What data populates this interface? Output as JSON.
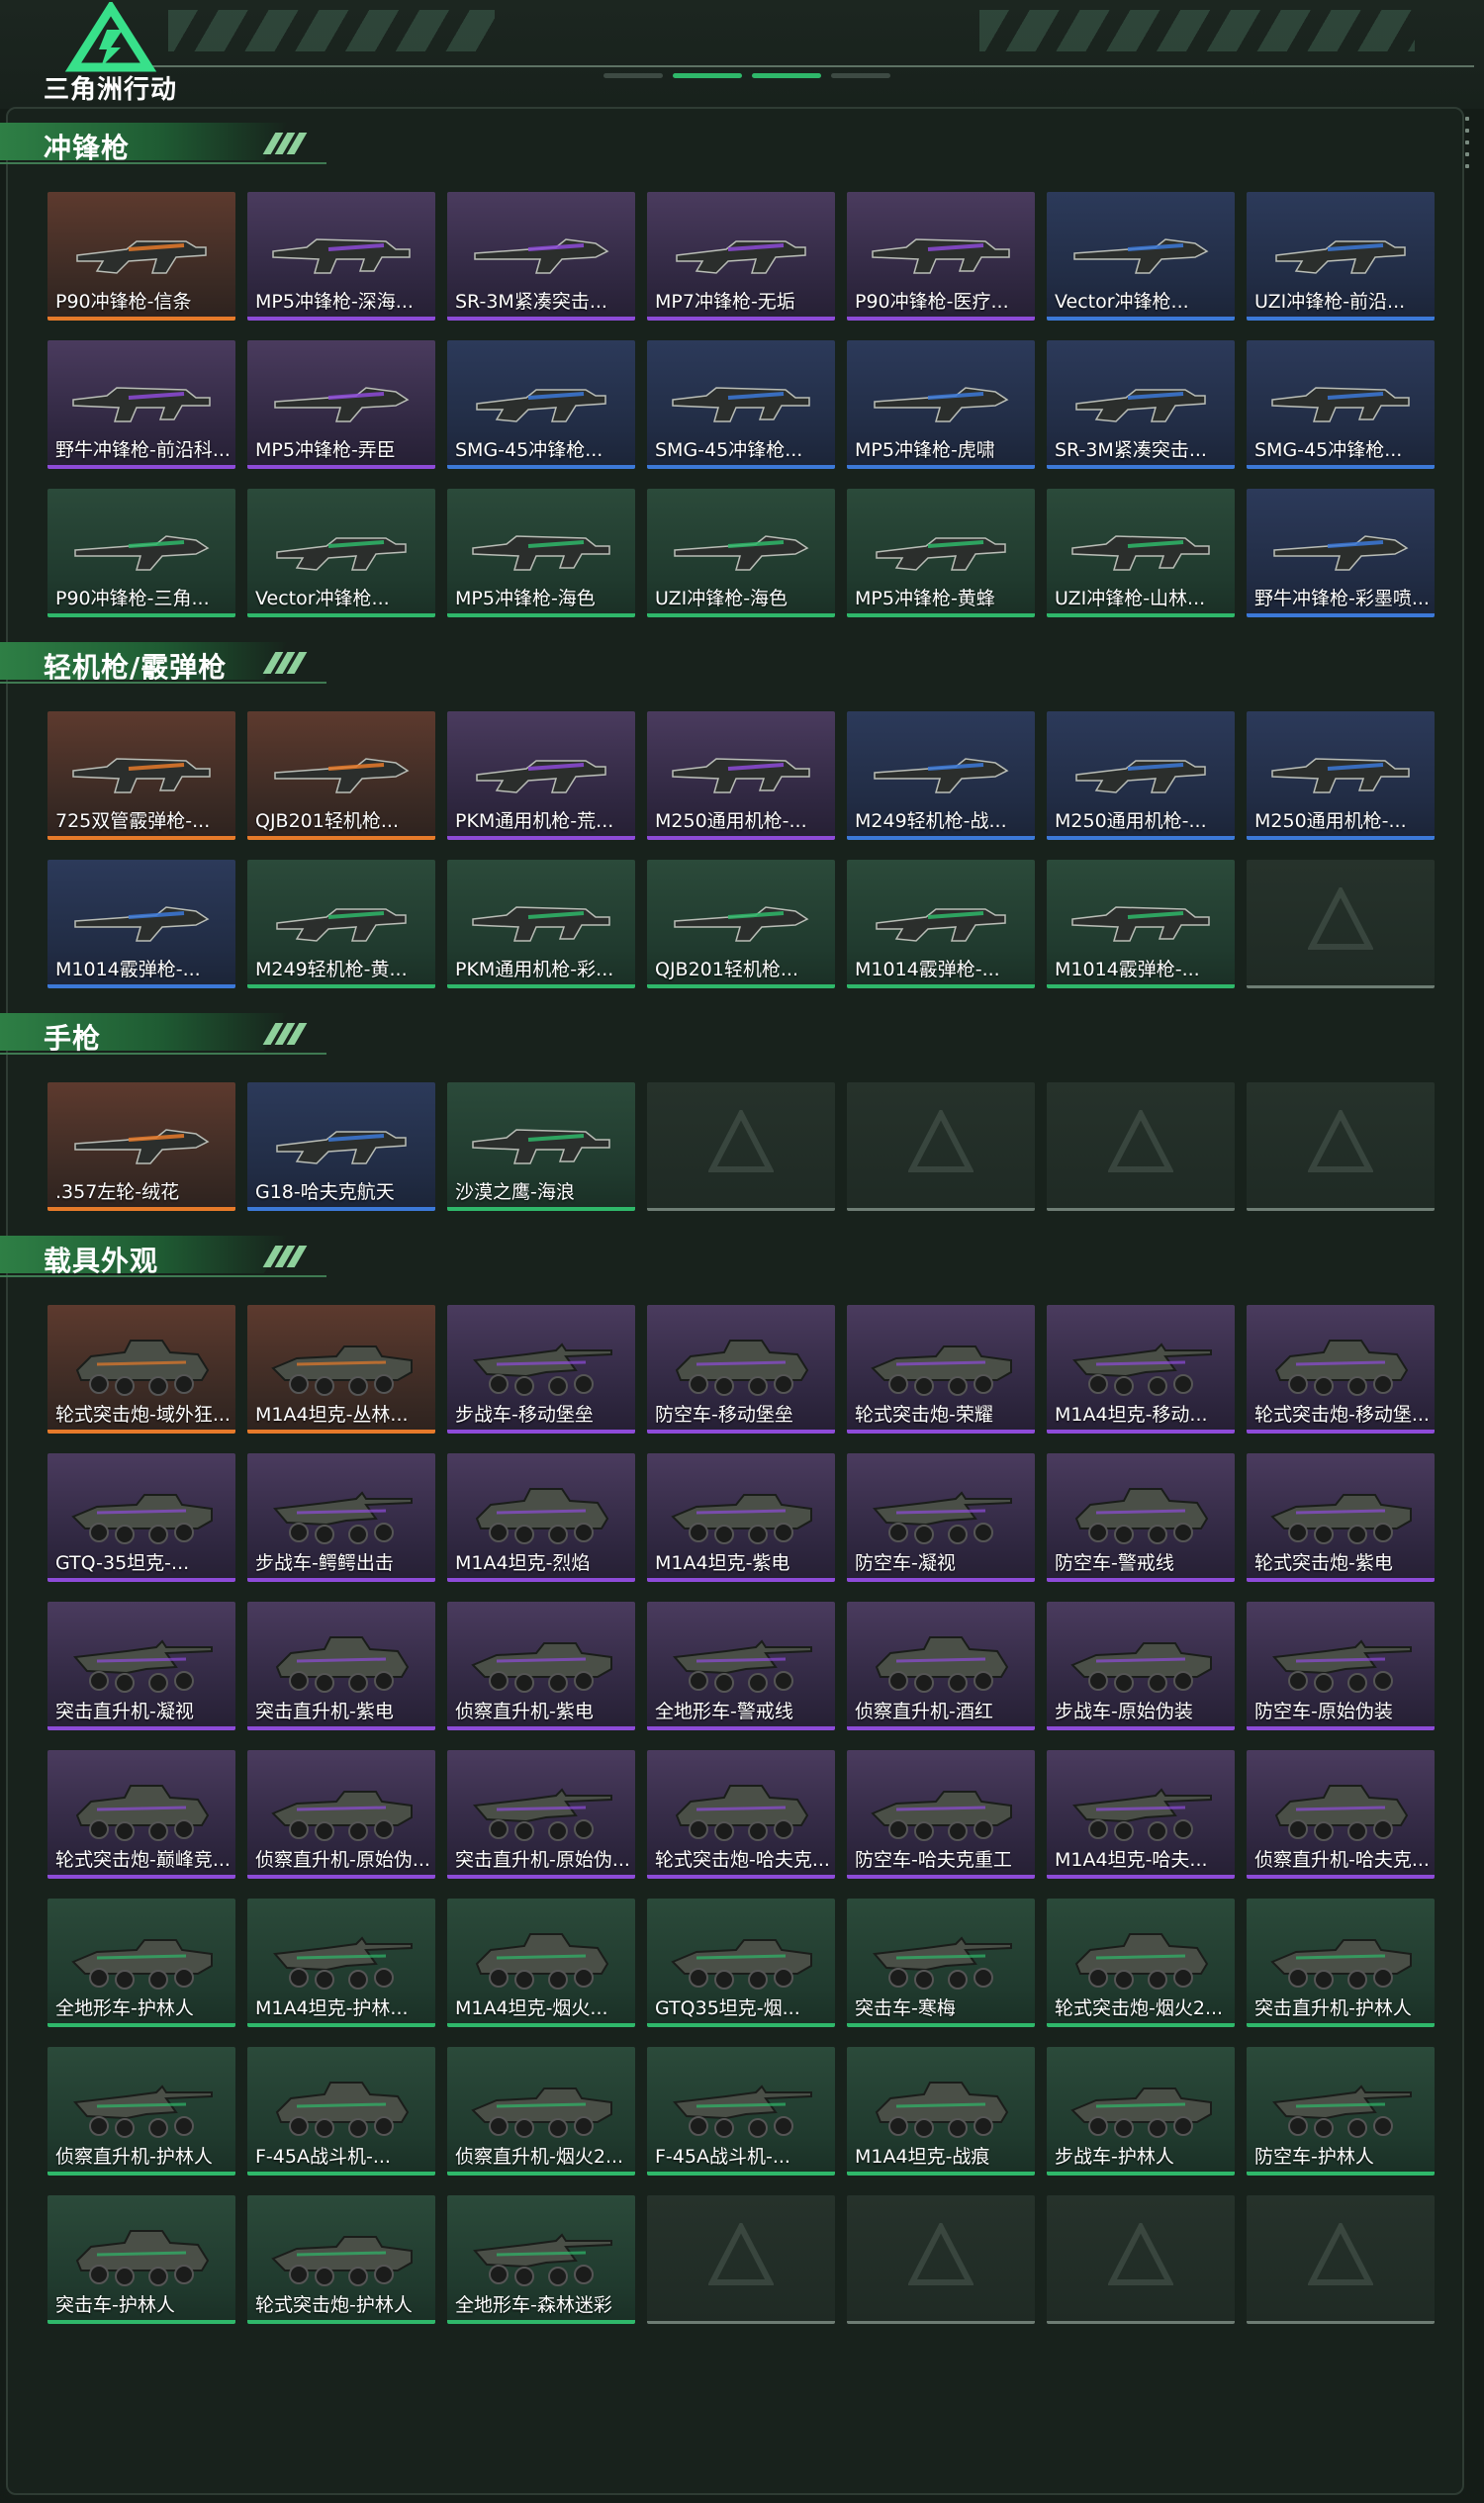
{
  "app": {
    "title": "三角洲行动"
  },
  "colors": {
    "orange": "#e67a2a",
    "purple": "#8d4bd8",
    "blue": "#3c79d8",
    "green": "#2fb86a",
    "accent": "#2e7f45"
  },
  "sections": [
    {
      "title": "冲锋枪",
      "kind": "weapon",
      "items": [
        {
          "name": "P90冲锋枪-信条",
          "rarity": "orange"
        },
        {
          "name": "MP5冲锋枪-深海...",
          "rarity": "purple"
        },
        {
          "name": "SR-3M紧凑突击...",
          "rarity": "purple"
        },
        {
          "name": "MP7冲锋枪-无垢",
          "rarity": "purple"
        },
        {
          "name": "P90冲锋枪-医疗...",
          "rarity": "purple"
        },
        {
          "name": "Vector冲锋枪...",
          "rarity": "blue"
        },
        {
          "name": "UZI冲锋枪-前沿...",
          "rarity": "blue"
        },
        {
          "name": "野牛冲锋枪-前沿科...",
          "rarity": "purple"
        },
        {
          "name": "MP5冲锋枪-弄臣",
          "rarity": "purple"
        },
        {
          "name": "SMG-45冲锋枪...",
          "rarity": "blue"
        },
        {
          "name": "SMG-45冲锋枪...",
          "rarity": "blue"
        },
        {
          "name": "MP5冲锋枪-虎啸",
          "rarity": "blue"
        },
        {
          "name": "SR-3M紧凑突击...",
          "rarity": "blue"
        },
        {
          "name": "SMG-45冲锋枪...",
          "rarity": "blue"
        },
        {
          "name": "P90冲锋枪-三角...",
          "rarity": "green"
        },
        {
          "name": "Vector冲锋枪...",
          "rarity": "green"
        },
        {
          "name": "MP5冲锋枪-海色",
          "rarity": "green"
        },
        {
          "name": "UZI冲锋枪-海色",
          "rarity": "green"
        },
        {
          "name": "MP5冲锋枪-黄蜂",
          "rarity": "green"
        },
        {
          "name": "UZI冲锋枪-山林...",
          "rarity": "green"
        },
        {
          "name": "野牛冲锋枪-彩墨喷...",
          "rarity": "blue"
        }
      ]
    },
    {
      "title": "轻机枪/霰弹枪",
      "kind": "weapon",
      "items": [
        {
          "name": "725双管霰弹枪-...",
          "rarity": "orange"
        },
        {
          "name": "QJB201轻机枪...",
          "rarity": "orange"
        },
        {
          "name": "PKM通用机枪-荒...",
          "rarity": "purple"
        },
        {
          "name": "M250通用机枪-...",
          "rarity": "purple"
        },
        {
          "name": "M249轻机枪-战...",
          "rarity": "blue"
        },
        {
          "name": "M250通用机枪-...",
          "rarity": "blue"
        },
        {
          "name": "M250通用机枪-...",
          "rarity": "blue"
        },
        {
          "name": "M1014霰弹枪-...",
          "rarity": "blue"
        },
        {
          "name": "M249轻机枪-黄...",
          "rarity": "green"
        },
        {
          "name": "PKM通用机枪-彩...",
          "rarity": "green"
        },
        {
          "name": "QJB201轻机枪...",
          "rarity": "green"
        },
        {
          "name": "M1014霰弹枪-...",
          "rarity": "green"
        },
        {
          "name": "M1014霰弹枪-...",
          "rarity": "green"
        },
        {
          "name": "",
          "rarity": "empty"
        }
      ]
    },
    {
      "title": "手枪",
      "kind": "weapon",
      "items": [
        {
          "name": ".357左轮-绒花",
          "rarity": "orange"
        },
        {
          "name": "G18-哈夫克航天",
          "rarity": "blue"
        },
        {
          "name": "沙漠之鹰-海浪",
          "rarity": "green"
        },
        {
          "name": "",
          "rarity": "empty"
        },
        {
          "name": "",
          "rarity": "empty"
        },
        {
          "name": "",
          "rarity": "empty"
        },
        {
          "name": "",
          "rarity": "empty"
        }
      ]
    },
    {
      "title": "载具外观",
      "kind": "vehicle",
      "items": [
        {
          "name": "轮式突击炮-域外狂...",
          "rarity": "orange"
        },
        {
          "name": "M1A4坦克-丛林...",
          "rarity": "orange"
        },
        {
          "name": "步战车-移动堡垒",
          "rarity": "purple"
        },
        {
          "name": "防空车-移动堡垒",
          "rarity": "purple"
        },
        {
          "name": "轮式突击炮-荣耀",
          "rarity": "purple"
        },
        {
          "name": "M1A4坦克-移动...",
          "rarity": "purple"
        },
        {
          "name": "轮式突击炮-移动堡...",
          "rarity": "purple"
        },
        {
          "name": "GTQ-35坦克-...",
          "rarity": "purple"
        },
        {
          "name": "步战车-鳄鳄出击",
          "rarity": "purple"
        },
        {
          "name": "M1A4坦克-烈焰",
          "rarity": "purple"
        },
        {
          "name": "M1A4坦克-紫电",
          "rarity": "purple"
        },
        {
          "name": "防空车-凝视",
          "rarity": "purple"
        },
        {
          "name": "防空车-警戒线",
          "rarity": "purple"
        },
        {
          "name": "轮式突击炮-紫电",
          "rarity": "purple"
        },
        {
          "name": "突击直升机-凝视",
          "rarity": "purple"
        },
        {
          "name": "突击直升机-紫电",
          "rarity": "purple"
        },
        {
          "name": "侦察直升机-紫电",
          "rarity": "purple"
        },
        {
          "name": "全地形车-警戒线",
          "rarity": "purple"
        },
        {
          "name": "侦察直升机-酒红",
          "rarity": "purple"
        },
        {
          "name": "步战车-原始伪装",
          "rarity": "purple"
        },
        {
          "name": "防空车-原始伪装",
          "rarity": "purple"
        },
        {
          "name": "轮式突击炮-巅峰竞...",
          "rarity": "purple"
        },
        {
          "name": "侦察直升机-原始伪...",
          "rarity": "purple"
        },
        {
          "name": "突击直升机-原始伪...",
          "rarity": "purple"
        },
        {
          "name": "轮式突击炮-哈夫克...",
          "rarity": "purple"
        },
        {
          "name": "防空车-哈夫克重工",
          "rarity": "purple"
        },
        {
          "name": "M1A4坦克-哈夫...",
          "rarity": "purple"
        },
        {
          "name": "侦察直升机-哈夫克...",
          "rarity": "purple"
        },
        {
          "name": "全地形车-护林人",
          "rarity": "green"
        },
        {
          "name": "M1A4坦克-护林...",
          "rarity": "green"
        },
        {
          "name": "M1A4坦克-烟火...",
          "rarity": "green"
        },
        {
          "name": "GTQ35坦克-烟...",
          "rarity": "green"
        },
        {
          "name": "突击车-寒梅",
          "rarity": "green"
        },
        {
          "name": "轮式突击炮-烟火2...",
          "rarity": "green"
        },
        {
          "name": "突击直升机-护林人",
          "rarity": "green"
        },
        {
          "name": "侦察直升机-护林人",
          "rarity": "green"
        },
        {
          "name": "F-45A战斗机-...",
          "rarity": "green"
        },
        {
          "name": "侦察直升机-烟火2...",
          "rarity": "green"
        },
        {
          "name": "F-45A战斗机-...",
          "rarity": "green"
        },
        {
          "name": "M1A4坦克-战痕",
          "rarity": "green"
        },
        {
          "name": "步战车-护林人",
          "rarity": "green"
        },
        {
          "name": "防空车-护林人",
          "rarity": "green"
        },
        {
          "name": "突击车-护林人",
          "rarity": "green"
        },
        {
          "name": "轮式突击炮-护林人",
          "rarity": "green"
        },
        {
          "name": "全地形车-森林迷彩",
          "rarity": "green"
        },
        {
          "name": "",
          "rarity": "empty"
        },
        {
          "name": "",
          "rarity": "empty"
        },
        {
          "name": "",
          "rarity": "empty"
        },
        {
          "name": "",
          "rarity": "empty"
        }
      ]
    }
  ]
}
